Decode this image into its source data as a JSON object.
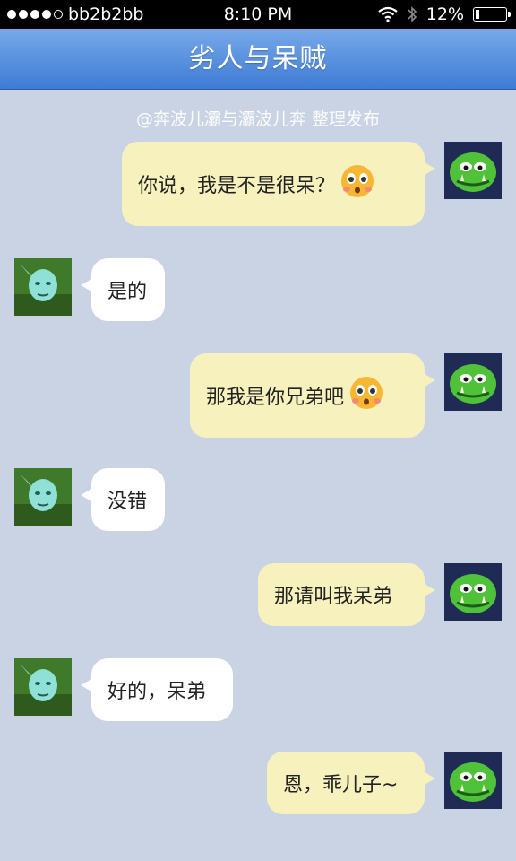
{
  "status_bar": {
    "carrier": "bb2b2bb",
    "time": "8:10 PM",
    "battery": "12%",
    "battery_level": 0.12,
    "signal_bars": 4,
    "signal_total": 5
  },
  "header": {
    "title": "劣人与呆贼"
  },
  "watermark": "@奔波儿灞与灞波儿奔 整理发布",
  "messages": [
    {
      "side": "right",
      "text": "你说，我是不是很呆？",
      "emoji": "crying-face-icon"
    },
    {
      "side": "left",
      "text": "是的"
    },
    {
      "side": "right",
      "text": "那我是你兄弟吧",
      "emoji": "crying-face-icon"
    },
    {
      "side": "left",
      "text": "没错"
    },
    {
      "side": "right",
      "text": "那请叫我呆弟"
    },
    {
      "side": "left",
      "text": "好的，呆弟"
    },
    {
      "side": "right",
      "text": "恩，乖儿子~"
    }
  ],
  "colors": {
    "background": "#c9d3e4",
    "header": "#4f86da",
    "right_bubble": "#f7f1bd",
    "left_bubble": "#ffffff"
  }
}
